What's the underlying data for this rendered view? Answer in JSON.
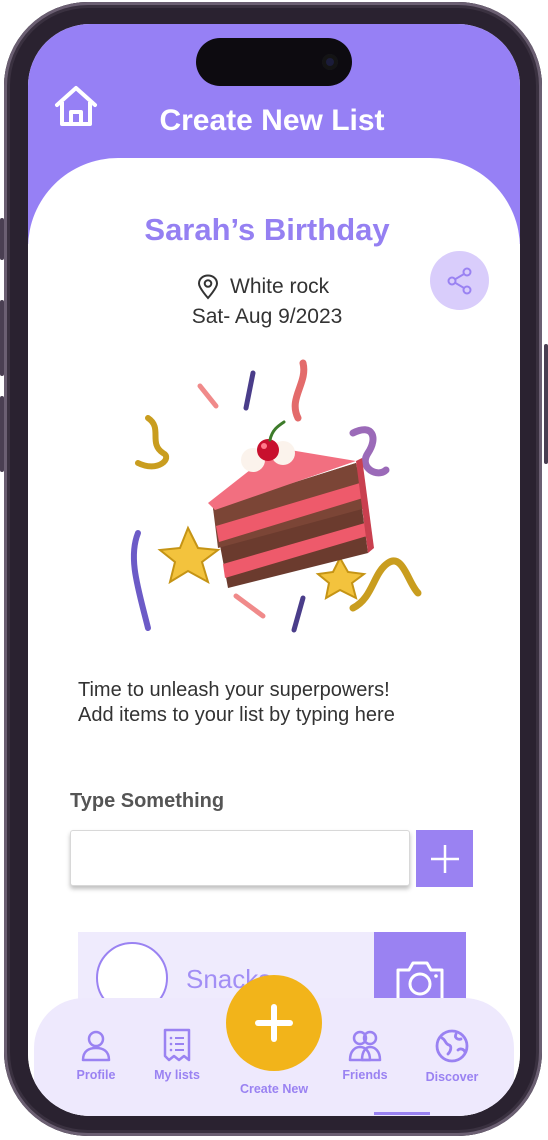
{
  "header": {
    "title": "Create New List"
  },
  "event": {
    "name": "Sarah’s Birthday",
    "location": "White rock",
    "date": "Sat- Aug 9/2023"
  },
  "prompt": {
    "line1": "Time to unleash your superpowers!",
    "line2": "Add items to your list by typing here"
  },
  "input": {
    "label": "Type Something",
    "value": "",
    "placeholder": ""
  },
  "list_items": [
    {
      "name": "Snacks"
    }
  ],
  "nav": {
    "items": [
      {
        "label": "Profile",
        "icon": "person-icon"
      },
      {
        "label": "My lists",
        "icon": "list-icon"
      },
      {
        "label": "Create New",
        "icon": "plus-icon"
      },
      {
        "label": "Friends",
        "icon": "friends-icon"
      },
      {
        "label": "Discover",
        "icon": "globe-icon"
      }
    ]
  },
  "colors": {
    "brand_purple": "#9680f5",
    "accent_yellow": "#f2b41a",
    "light_purple": "#efebfd"
  }
}
